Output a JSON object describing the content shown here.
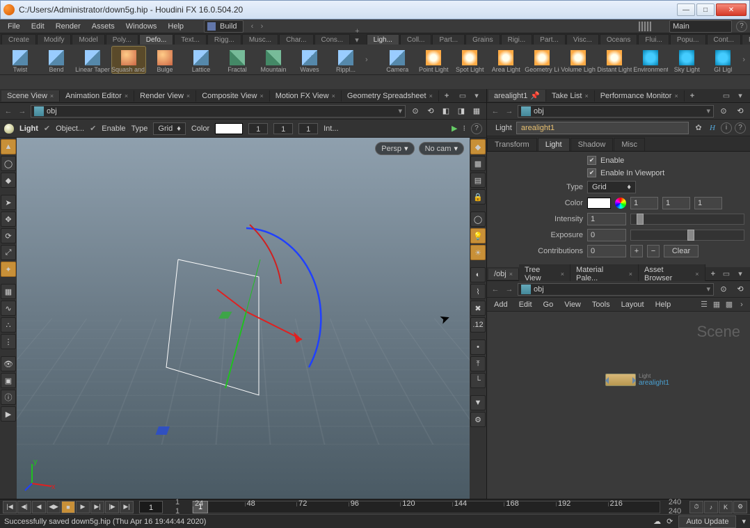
{
  "window": {
    "title": "C:/Users/Administrator/down5g.hip - Houdini FX 16.0.504.20"
  },
  "menubar": {
    "items": [
      "File",
      "Edit",
      "Render",
      "Assets",
      "Windows",
      "Help"
    ],
    "desktop": "Build",
    "take": "Main"
  },
  "shelves": {
    "left_tabs": [
      "Create",
      "Modify",
      "Model",
      "Poly...",
      "Defo...",
      "Text...",
      "Rigg...",
      "Musc...",
      "Char...",
      "Cons..."
    ],
    "left_active": 4,
    "right_tabs": [
      "Ligh...",
      "Coll...",
      "Part...",
      "Grains",
      "Rigi...",
      "Part...",
      "Visc...",
      "Oceans",
      "Flui...",
      "Popu...",
      "Cont...",
      "Pyro..."
    ],
    "right_active": 0,
    "tools_left": [
      {
        "label": "Twist",
        "icon": "ic-cube"
      },
      {
        "label": "Bend",
        "icon": "ic-cube"
      },
      {
        "label": "Linear Taper",
        "icon": "ic-cube"
      },
      {
        "label": "Squash and Stretch",
        "icon": "ic-sphere",
        "hl": true
      },
      {
        "label": "Bulge",
        "icon": "ic-sphere"
      },
      {
        "label": "Lattice",
        "icon": "ic-cube"
      },
      {
        "label": "Fractal",
        "icon": "ic-mtn"
      },
      {
        "label": "Mountain",
        "icon": "ic-mtn"
      },
      {
        "label": "Waves",
        "icon": "ic-cube"
      },
      {
        "label": "Rippl...",
        "icon": "ic-cube"
      }
    ],
    "tools_right": [
      {
        "label": "Camera",
        "icon": "ic-cube"
      },
      {
        "label": "Point Light",
        "icon": "ic-light"
      },
      {
        "label": "Spot Light",
        "icon": "ic-light"
      },
      {
        "label": "Area Light",
        "icon": "ic-light"
      },
      {
        "label": "Geometry Light",
        "icon": "ic-light"
      },
      {
        "label": "Volume Light",
        "icon": "ic-light"
      },
      {
        "label": "Distant Light",
        "icon": "ic-light"
      },
      {
        "label": "Environment Light",
        "icon": "ic-env"
      },
      {
        "label": "Sky Light",
        "icon": "ic-env"
      },
      {
        "label": "GI Ligl",
        "icon": "ic-env"
      }
    ]
  },
  "left_pane": {
    "tabs": [
      "Scene View",
      "Animation Editor",
      "Render View",
      "Composite View",
      "Motion FX View",
      "Geometry Spreadsheet"
    ],
    "active": 0,
    "path": "obj",
    "op": {
      "name": "Light",
      "handle": "Object...",
      "enable": "Enable",
      "type_lbl": "Type",
      "type_val": "Grid",
      "color_lbl": "Color",
      "c1": "1",
      "c2": "1",
      "c3": "1",
      "intensity": "Int..."
    },
    "viewport": {
      "cam": "Persp",
      "nocam": "No cam"
    }
  },
  "right_pane_top": {
    "tabs": [
      "arealight1",
      "Take List",
      "Performance Monitor"
    ],
    "active": 0,
    "path": "obj",
    "node_type": "Light",
    "node_name": "arealight1",
    "parm_tabs": [
      "Transform",
      "Light",
      "Shadow",
      "Misc"
    ],
    "parm_active": 1,
    "parms": {
      "enable": "Enable",
      "enable_vp": "Enable In Viewport",
      "type_lbl": "Type",
      "type_val": "Grid",
      "color_lbl": "Color",
      "c1": "1",
      "c2": "1",
      "c3": "1",
      "intensity_lbl": "Intensity",
      "intensity": "1",
      "exposure_lbl": "Exposure",
      "exposure": "0",
      "contrib_lbl": "Contributions",
      "contrib": "0",
      "clear": "Clear"
    }
  },
  "right_pane_bottom": {
    "tabs": [
      "/obj",
      "Tree View",
      "Material Pale...",
      "Asset Browser"
    ],
    "active": 0,
    "path": "obj",
    "menu": [
      "Add",
      "Edit",
      "Go",
      "View",
      "Tools",
      "Layout",
      "Help"
    ],
    "scene_label": "Scene",
    "node_name": "arealight1",
    "node_type": "Light"
  },
  "timeline": {
    "current": "1",
    "start": "1",
    "start2": "1",
    "ticks": [
      "24",
      "48",
      "72",
      "96",
      "120",
      "144",
      "168",
      "192",
      "216"
    ],
    "end": "240",
    "end2": "240"
  },
  "status": {
    "msg": "Successfully saved down5g.hip (Thu Apr 16 19:44:44 2020)",
    "update": "Auto Update"
  }
}
